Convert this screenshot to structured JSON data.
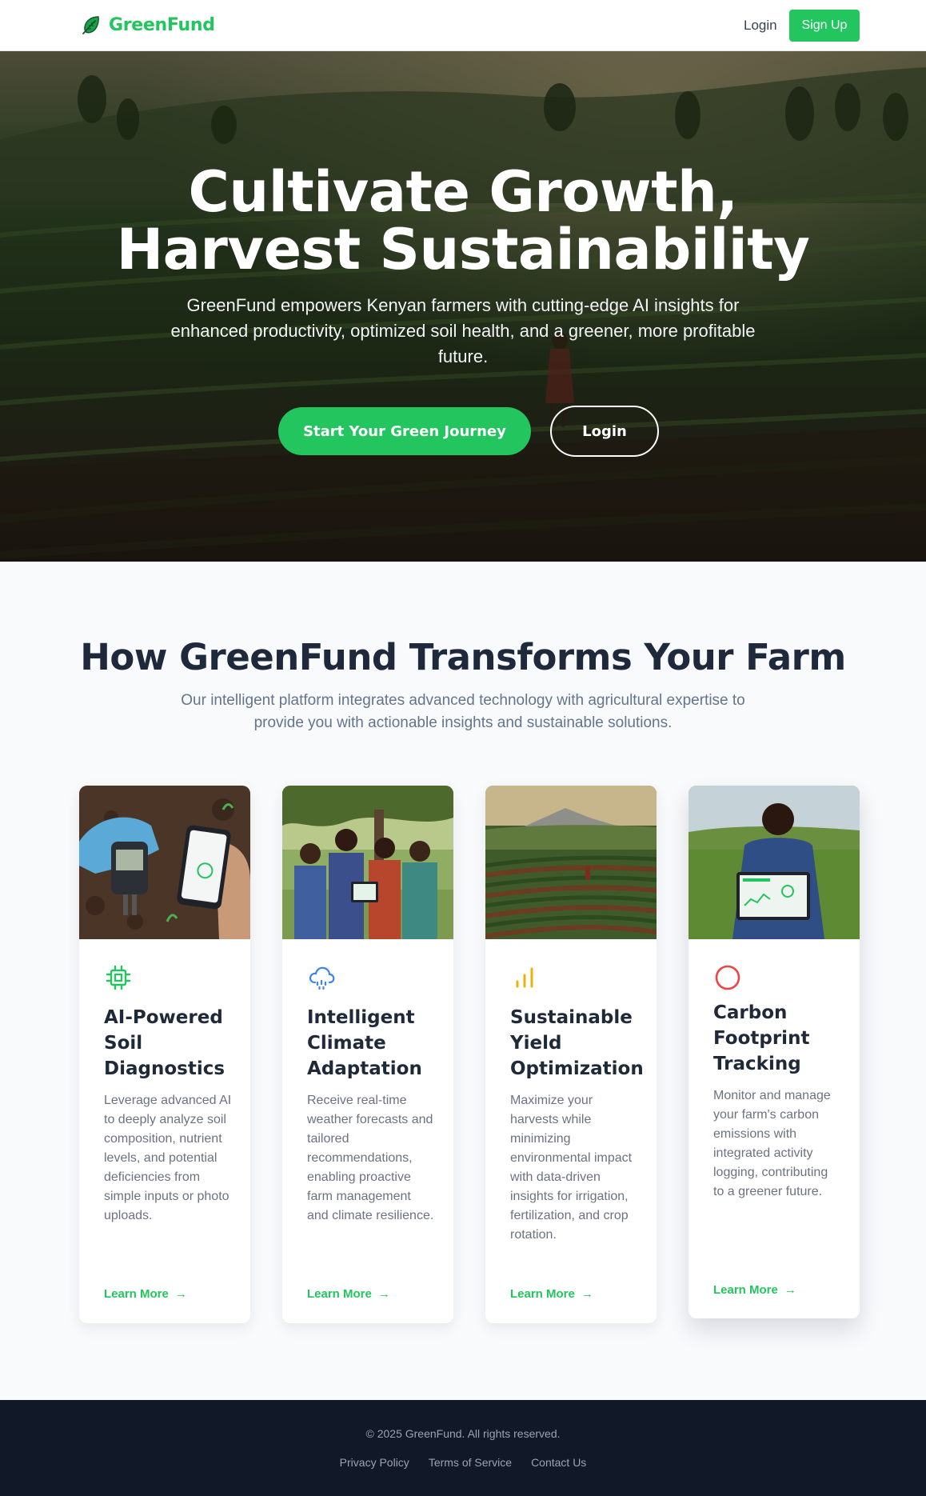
{
  "nav": {
    "brand": "GreenFund",
    "login": "Login",
    "signup": "Sign Up"
  },
  "hero": {
    "title_line1": "Cultivate Growth,",
    "title_line2": "Harvest Sustainability",
    "subtitle": "GreenFund empowers Kenyan farmers with cutting-edge AI insights for enhanced productivity, optimized soil health, and a greener, more profitable future.",
    "cta": "Start Your Green Journey",
    "login": "Login"
  },
  "features": {
    "title": "How GreenFund Transforms Your Farm",
    "subtitle": "Our intelligent platform integrates advanced technology with agricultural expertise to provide you with actionable insights and sustainable solutions.",
    "cards": [
      {
        "icon": "chip-icon",
        "title": "AI-Powered Soil Diagnostics",
        "description": "Leverage advanced AI to deeply analyze soil composition, nutrient levels, and potential deficiencies from simple inputs or photo uploads.",
        "link": "Learn More"
      },
      {
        "icon": "cloud-rain-icon",
        "title": "Intelligent Climate Adaptation",
        "description": "Receive real-time weather forecasts and tailored recommendations, enabling proactive farm management and climate resilience.",
        "link": "Learn More"
      },
      {
        "icon": "bar-chart-icon",
        "title": "Sustainable Yield Optimization",
        "description": "Maximize your harvests while minimizing environmental impact with data-driven insights for irrigation, fertilization, and crop rotation.",
        "link": "Learn More"
      },
      {
        "icon": "circle-icon",
        "title": "Carbon Footprint Tracking",
        "description": "Monitor and manage your farm's carbon emissions with integrated activity logging, contributing to a greener future.",
        "link": "Learn More"
      }
    ]
  },
  "footer": {
    "copyright": "© 2025 GreenFund. All rights reserved.",
    "links": [
      "Privacy Policy",
      "Terms of Service",
      "Contact Us"
    ]
  },
  "colors": {
    "brand_green": "#22c55e",
    "dark_navy": "#111827",
    "heading": "#1e293b"
  }
}
